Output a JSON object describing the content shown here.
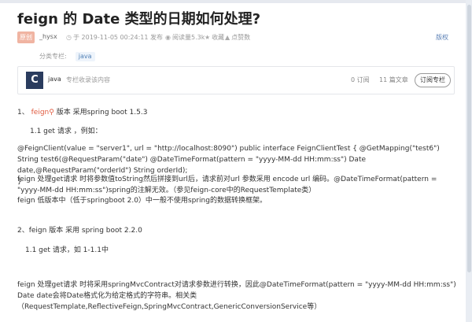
{
  "article": {
    "title": "feign 的 Date 类型的日期如何处理?",
    "original_badge": "原创",
    "author": "_hysx",
    "published": "于 2019-11-05 00:24:11 发布",
    "views": "阅读量5.3k",
    "favorite": "收藏",
    "likes": "点赞数",
    "copyright": "版权",
    "category_label": "分类专栏:",
    "category_tag": "java"
  },
  "column": {
    "logo_letter": "C",
    "name": "java",
    "description": "专栏收录该内容",
    "subscriptions": "0 订阅",
    "articles": "11 篇文章",
    "subscribe_button": "订阅专栏"
  },
  "body": {
    "p1_prefix": "1、",
    "p1_keyword": "feign",
    "p1_rest": "版本 采用spring boot 1.5.3",
    "p2": "1.1 get 请求 ，例如：",
    "p3": "@FeignClient(value = \"server1\", url = \"http://localhost:8090\") public interface FeignClientTest { @GetMapping(\"test6\") String test6(@RequestParam(\"date\") @DateTimeFormat(pattern = \"yyyy-MM-dd HH:mm:ss\") Date date,@RequestParam(\"orderId\") String orderId);\n}",
    "p4": "feign 处理get请求 时将参数值toString然后拼接到url后，请求前对url 参数采用 encode url 编码。@DateTimeFormat(pattern = \"yyyy-MM-dd HH:mm:ss\")spring的注解无效。（参见feign-core中的RequestTemplate类）",
    "p5": "feign 低版本中（低于springboot 2.0）中一般不使用spring的数据转换框架。",
    "p6": "2、feign 版本 采用 spring boot 2.2.0",
    "p7": "1.1 get 请求，如 1-1.1中",
    "p8": "feign 处理get请求 时将采用springMvcContract对请求参数进行转换，因此@DateTimeFormat(pattern = \"yyyy-MM-dd HH:mm:ss\") Date date会将Date格式化为给定格式的字符串。相关类（RequestTemplate,ReflectiveFeign,SpringMvcContract,GenericConversionService等）"
  },
  "icons": {
    "published": "clock-icon",
    "views": "eye-icon",
    "favorite": "star-icon",
    "likes": "thumbs-up-icon",
    "search": "search-icon"
  }
}
